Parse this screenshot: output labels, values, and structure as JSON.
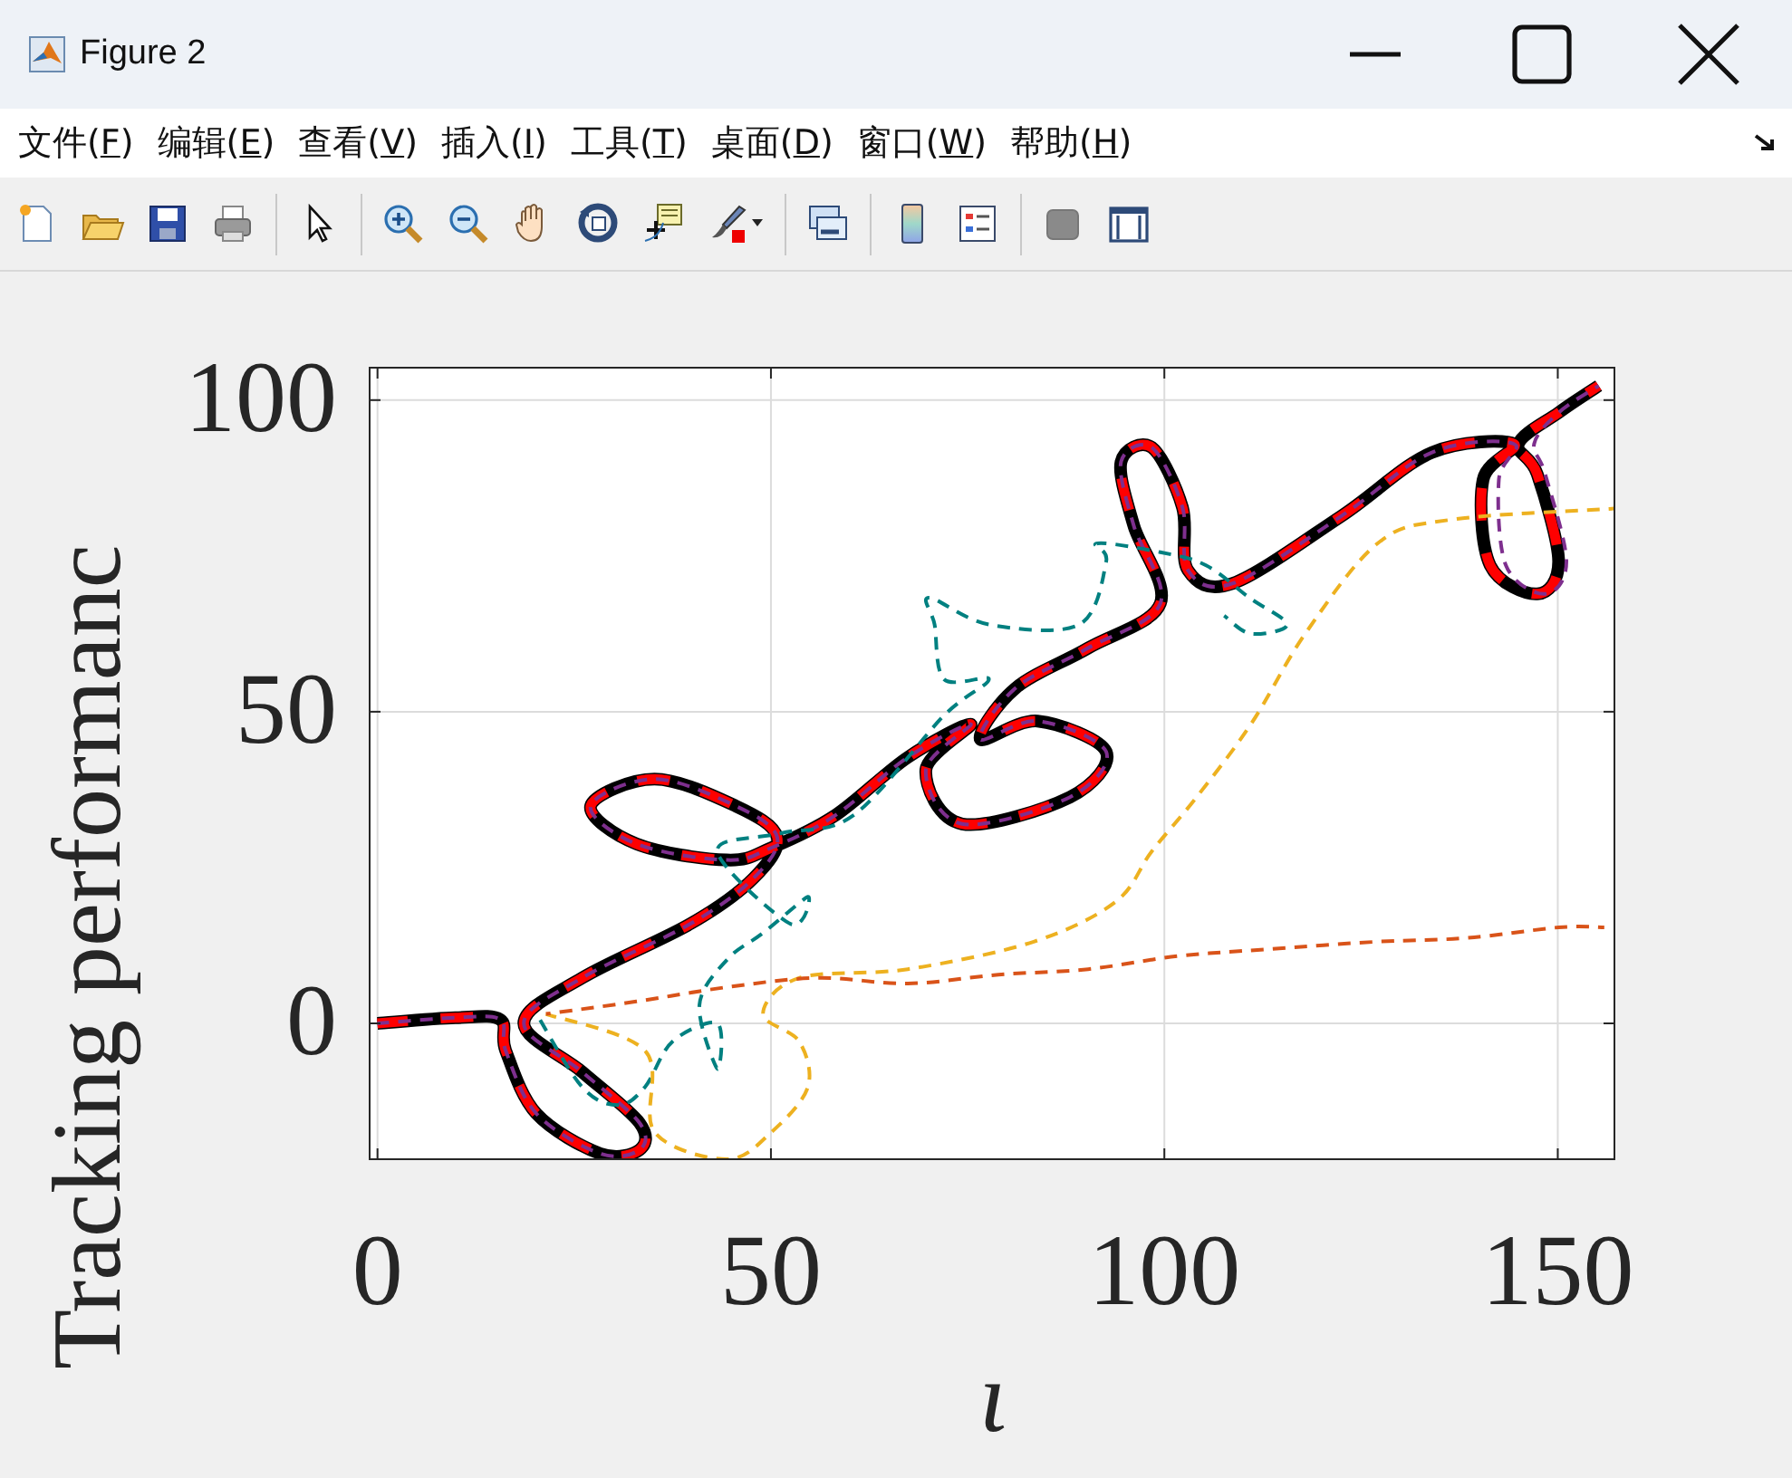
{
  "window": {
    "title": "Figure 2"
  },
  "menu": [
    {
      "label": "文件(F)"
    },
    {
      "label": "编辑(E)"
    },
    {
      "label": "查看(V)"
    },
    {
      "label": "插入(I)"
    },
    {
      "label": "工具(T)"
    },
    {
      "label": "桌面(D)"
    },
    {
      "label": "窗口(W)"
    },
    {
      "label": "帮助(H)"
    }
  ],
  "toolbar": [
    {
      "kind": "new"
    },
    {
      "kind": "open"
    },
    {
      "kind": "save"
    },
    {
      "kind": "print"
    },
    {
      "kind": "sep"
    },
    {
      "kind": "pointer"
    },
    {
      "kind": "sep"
    },
    {
      "kind": "zoomin"
    },
    {
      "kind": "zoomout"
    },
    {
      "kind": "pan"
    },
    {
      "kind": "rotate"
    },
    {
      "kind": "datatip"
    },
    {
      "kind": "brush"
    },
    {
      "kind": "sep"
    },
    {
      "kind": "link"
    },
    {
      "kind": "sep"
    },
    {
      "kind": "colorbar"
    },
    {
      "kind": "legend"
    },
    {
      "kind": "sep"
    },
    {
      "kind": "hide"
    },
    {
      "kind": "dock"
    }
  ],
  "figure": {
    "chart_data": {
      "type": "line",
      "grid": true,
      "xlabel": "ι",
      "ylabel": "Tracking performanc",
      "xlim": [
        -1,
        157.2
      ],
      "ylim": [
        -21.8,
        105.2
      ],
      "xticks": [
        0,
        50,
        100,
        150
      ],
      "yticks": [
        0,
        50,
        100
      ],
      "series": [
        {
          "color": "#000000",
          "line_style": "solid",
          "x": [
            0,
            9.9,
            15.6,
            16.3,
            20.2,
            28.3,
            33.3,
            33.3,
            26,
            18.6,
            26,
            39.8,
            47.8,
            50.8,
            45.5,
            35.2,
            27.1,
            32.9,
            44.4,
            50.1,
            58.2,
            67.4,
            75.4,
            69.7,
            74.3,
            88,
            92.6,
            83.9,
            76.6,
            81.1,
            90.3,
            99.5,
            96.1,
            94.5,
            98.4,
            102.3,
            103,
            108.7,
            122.5,
            134,
            144.4,
            140.5,
            141.4,
            147.4,
            150.1,
            147.4,
            145,
            150.1,
            155.2
          ],
          "values": [
            0,
            0.9,
            0.6,
            -4.4,
            -14.5,
            -20.9,
            -20.3,
            -16,
            -7.8,
            0,
            7.3,
            16,
            23.3,
            29.9,
            34.9,
            39.2,
            34.9,
            28.8,
            26.2,
            28.2,
            33.4,
            42.7,
            48,
            40.7,
            32,
            36.3,
            43.6,
            48.5,
            45.6,
            53.8,
            60.2,
            67.4,
            79.9,
            90.1,
            92.4,
            82.8,
            72.7,
            70.6,
            81.4,
            91.6,
            93,
            87.2,
            73.5,
            68.9,
            74.1,
            88.1,
            93,
            98,
            102.3
          ]
        },
        {
          "color": "#ff0000",
          "line_style": "dashed",
          "x": [
            0,
            9.9,
            15.6,
            16.3,
            20.2,
            28.3,
            33.3,
            33.3,
            26,
            18.6,
            26,
            39.8,
            47.8,
            50.8,
            45.5,
            35.2,
            27.1,
            32.9,
            44.4,
            50.1,
            58.2,
            67.4,
            75.4,
            69.7,
            74.3,
            88,
            92.6,
            83.9,
            76.6,
            81.1,
            90.3,
            99.5,
            96.1,
            94.5,
            98.4,
            102.3,
            103,
            108.7,
            122.5,
            134,
            144.4,
            140.5,
            141.4,
            147.4,
            150.1,
            147.4,
            145,
            150.1,
            155.2
          ],
          "values": [
            0,
            0.9,
            0.6,
            -4.4,
            -14.5,
            -20.9,
            -20.3,
            -16,
            -7.8,
            0,
            7.3,
            16,
            23.3,
            29.9,
            34.9,
            39.2,
            34.9,
            28.8,
            26.2,
            28.2,
            33.4,
            42.7,
            48,
            40.7,
            32,
            36.3,
            43.6,
            48.5,
            45.6,
            53.8,
            60.2,
            67.4,
            79.9,
            90.1,
            92.4,
            82.8,
            72.7,
            70.6,
            81.4,
            91.6,
            93,
            87.2,
            73.5,
            68.9,
            74.1,
            88.1,
            93,
            98,
            102.3
          ]
        },
        {
          "color": "#7e2f8e",
          "line_style": "dashed",
          "x": [
            0,
            9.9,
            15.6,
            16.3,
            20.2,
            28.3,
            33.3,
            33.3,
            26,
            18.6,
            26,
            39.8,
            47.8,
            50.8,
            45.5,
            35.2,
            27.1,
            32.9,
            44.4,
            50.1,
            58.2,
            67.4,
            75.4,
            69.7,
            74.3,
            88,
            92.6,
            83.9,
            76.6,
            81.1,
            90.3,
            99.5,
            96.1,
            94.5,
            98.4,
            102.3,
            103,
            108.7,
            122.5,
            134,
            144.4,
            142.5,
            143.4,
            148.4,
            151.1,
            148.4,
            147,
            150.1,
            155.2
          ],
          "values": [
            0,
            0.9,
            0.6,
            -4.4,
            -14.5,
            -20.9,
            -20.3,
            -16,
            -7.8,
            0,
            7.3,
            16,
            23.3,
            29.9,
            34.9,
            39.2,
            34.9,
            28.8,
            26.2,
            28.2,
            33.4,
            42.7,
            48,
            40.7,
            32,
            36.3,
            43.6,
            48.5,
            45.6,
            53.8,
            60.2,
            67.4,
            79.9,
            90.1,
            92.4,
            82.8,
            72.7,
            70.6,
            81.4,
            91.6,
            93,
            87.2,
            73.5,
            68.9,
            74.1,
            88.1,
            93,
            98,
            102.3
          ]
        },
        {
          "color": "#008080",
          "line_style": "dashed",
          "x": [
            20.2,
            26,
            30.6,
            34,
            37.5,
            43.2,
            43.2,
            40.9,
            44.4,
            49,
            54.7,
            52.4,
            43.2,
            51.3,
            60.5,
            72,
            77.7,
            72,
            70.8,
            70.1,
            77.7,
            89.2,
            92.6,
            91.5,
            99.5,
            105.3,
            110.8,
            115.6,
            111,
            107.6
          ],
          "values": [
            1.5,
            -10.2,
            -13.1,
            -10.2,
            -2.9,
            0,
            -7.3,
            2.9,
            10.2,
            14.5,
            20.3,
            16,
            27.6,
            30.5,
            33.4,
            49.4,
            55.2,
            55.2,
            64,
            68.3,
            64,
            64,
            74.1,
            77,
            75.6,
            73.5,
            68.3,
            64,
            62.5,
            65.4
          ]
        },
        {
          "color": "#edb120",
          "line_style": "dashed",
          "x": [
            21.4,
            34,
            35.2,
            44.4,
            50.1,
            54.7,
            53.6,
            49,
            53.6,
            67.4,
            83.4,
            93.8,
            98.4,
            104.1,
            111,
            117.9,
            127.1,
            136.3,
            157.2
          ],
          "values": [
            1.5,
            -4.4,
            -17.4,
            -21.8,
            -17.4,
            -10.2,
            -2.9,
            1.5,
            7.3,
            8.7,
            13.1,
            19.5,
            27.6,
            36.3,
            48,
            62.5,
            77,
            80.8,
            82.6
          ]
        },
        {
          "color": "#d95319",
          "line_style": "dashed",
          "x": [
            21.4,
            32.9,
            44.4,
            55.9,
            67.4,
            78.9,
            90.3,
            101.8,
            113.3,
            127.1,
            138.6,
            150.1,
            155.9
          ],
          "values": [
            1.5,
            3.5,
            5.8,
            7.3,
            6.4,
            7.8,
            8.7,
            10.8,
            11.9,
            13.1,
            13.7,
            15.4,
            15.4
          ]
        }
      ]
    }
  }
}
